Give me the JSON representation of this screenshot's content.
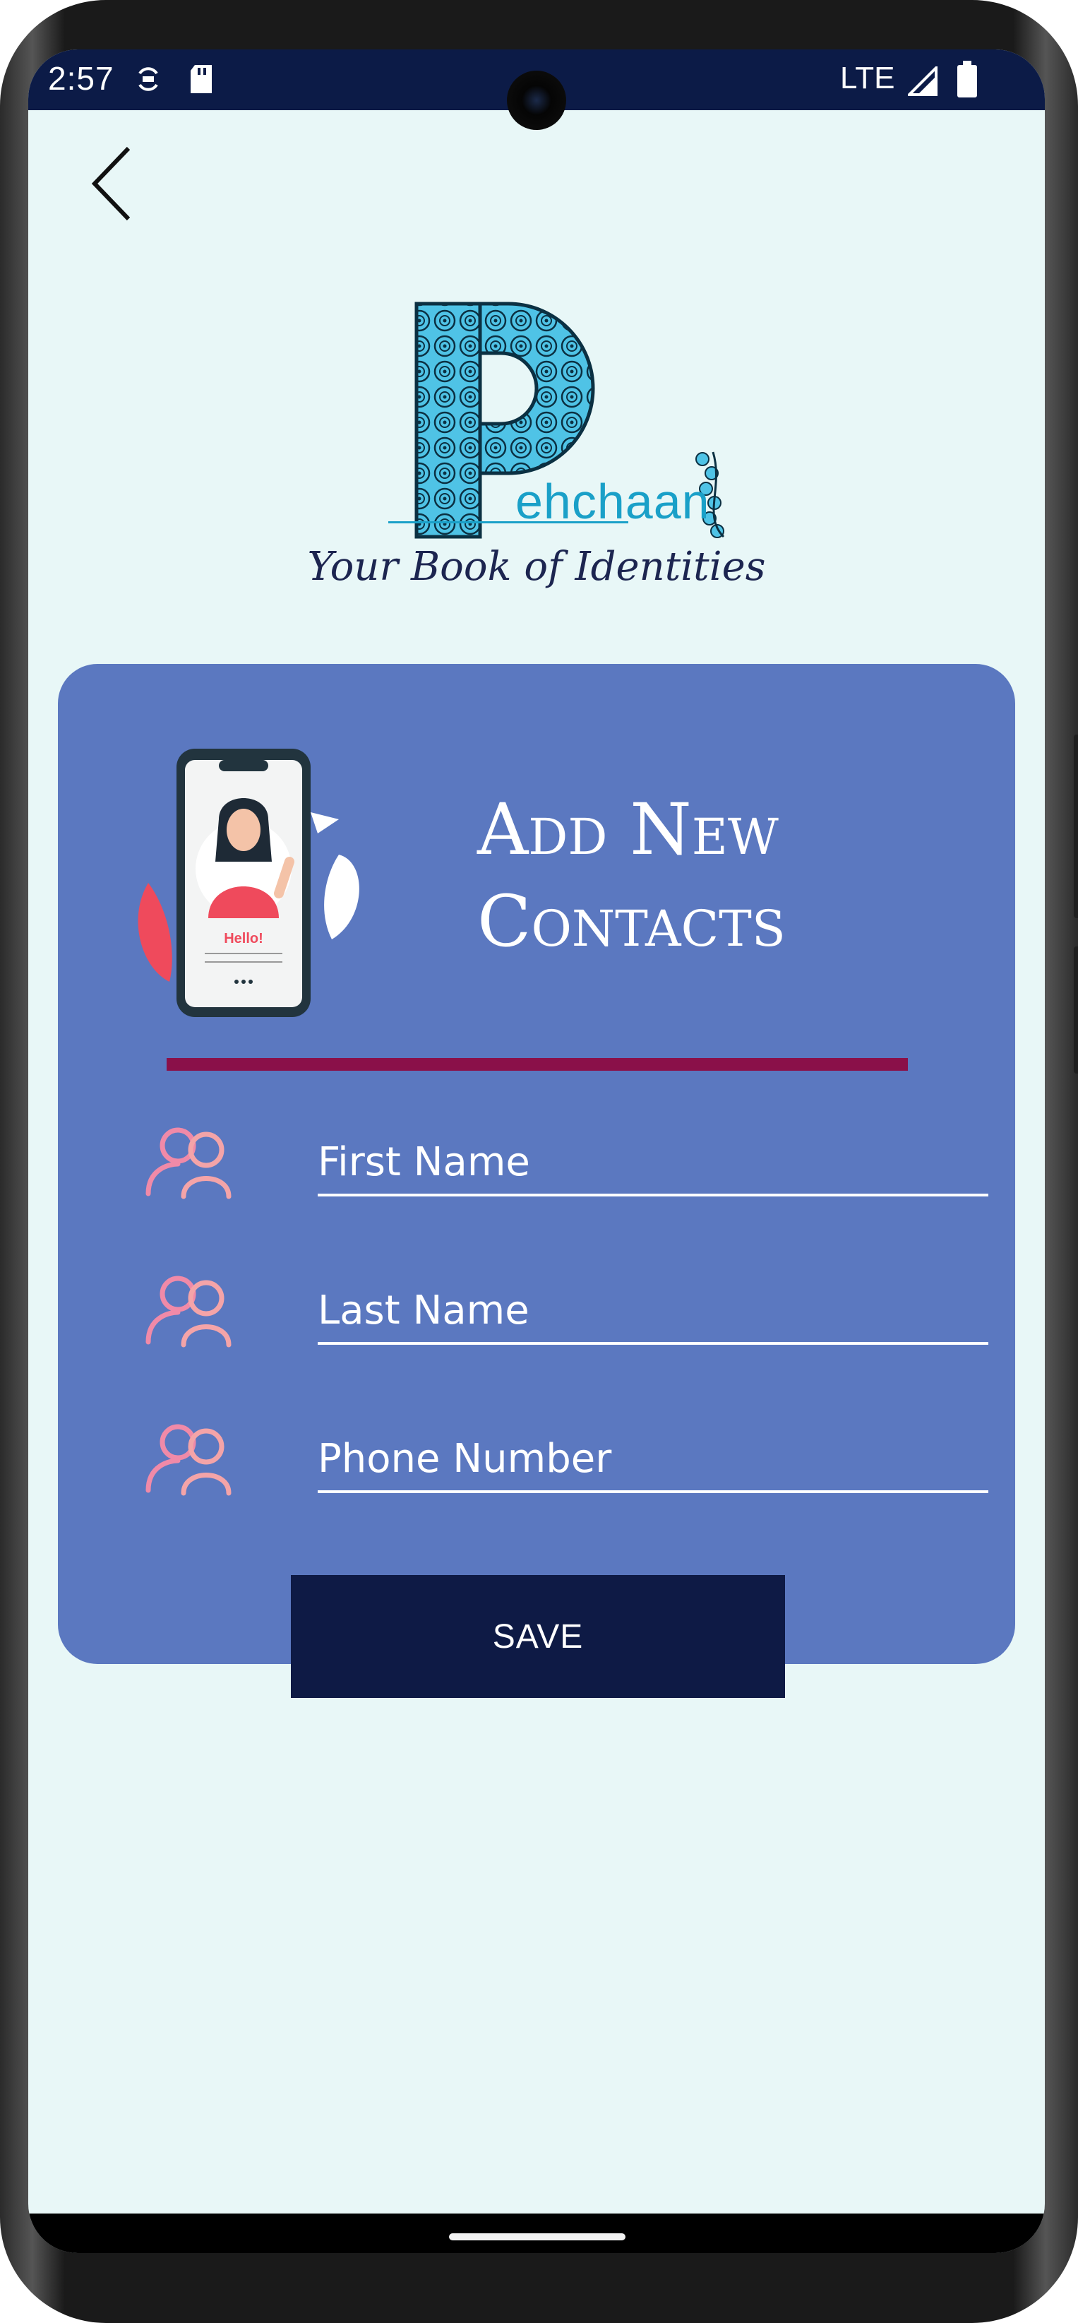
{
  "status_bar": {
    "time": "2:57",
    "network": "LTE",
    "icons": [
      "sync-icon",
      "sd-card-icon",
      "signal-icon",
      "battery-icon"
    ]
  },
  "header": {
    "back_icon": "chevron-left-icon",
    "logo_word": "ehchaan",
    "tagline": "Your Book of Identities"
  },
  "card": {
    "title": "Add New Contacts",
    "illustration_text": "Hello!",
    "fields": [
      {
        "icon": "users-icon",
        "placeholder": "First Name",
        "value": ""
      },
      {
        "icon": "users-icon",
        "placeholder": "Last Name",
        "value": ""
      },
      {
        "icon": "users-icon",
        "placeholder": "Phone Number",
        "value": ""
      }
    ],
    "save_label": "SAVE"
  },
  "colors": {
    "status_bar": "#0c1b47",
    "background": "#e8f7f7",
    "card": "#5b78c0",
    "divider": "#8a1049",
    "button": "#0e1a45",
    "icon_pink": "#f08aa8"
  }
}
